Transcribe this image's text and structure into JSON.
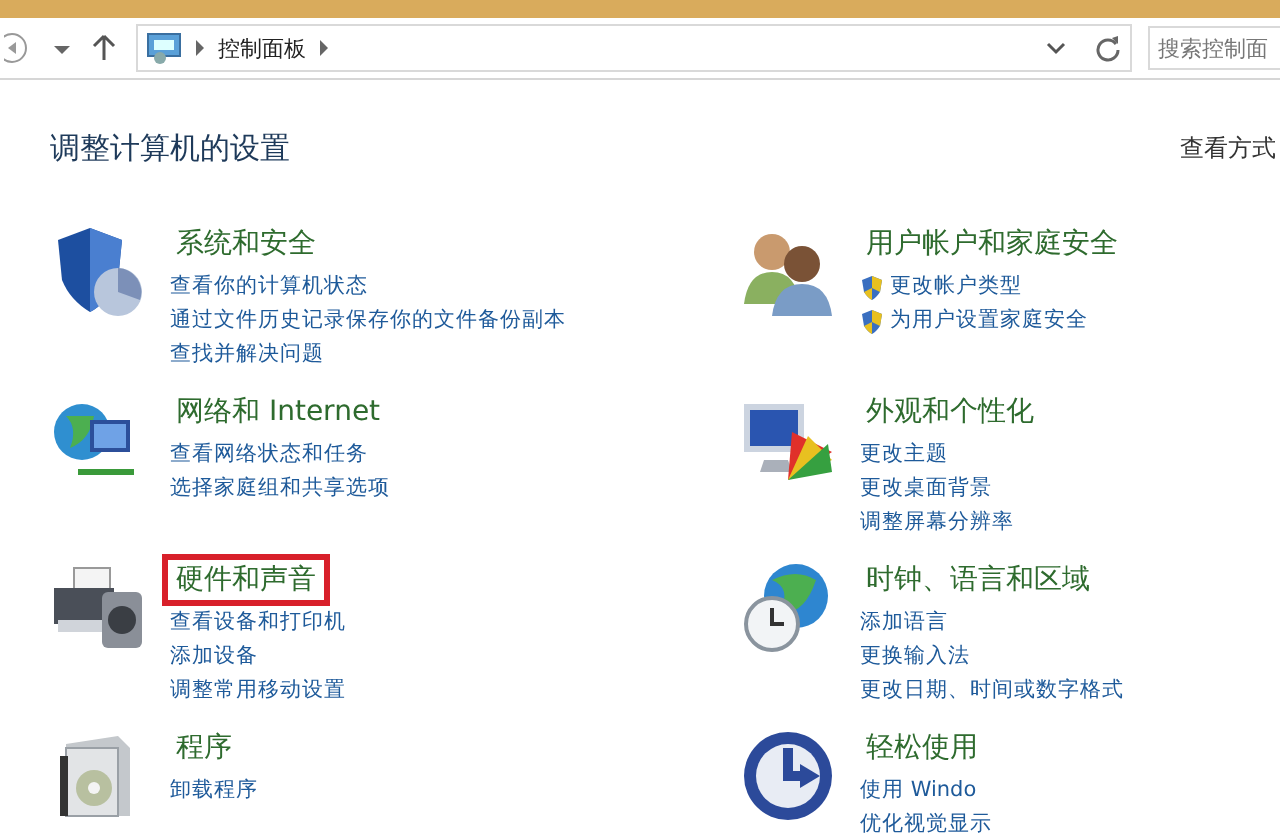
{
  "address_bar": {
    "path": "控制面板"
  },
  "search": {
    "placeholder": "搜索控制面"
  },
  "heading": "调整计算机的设置",
  "view_by": "查看方式",
  "categories": [
    {
      "title": "系统和安全",
      "highlighted": false,
      "links": [
        {
          "text": "查看你的计算机状态",
          "uac": false
        },
        {
          "text": "通过文件历史记录保存你的文件备份副本",
          "uac": false
        },
        {
          "text": "查找并解决问题",
          "uac": false
        }
      ]
    },
    {
      "title": "用户帐户和家庭安全",
      "highlighted": false,
      "links": [
        {
          "text": "更改帐户类型",
          "uac": true
        },
        {
          "text": "为用户设置家庭安全",
          "uac": true
        }
      ]
    },
    {
      "title": "网络和 Internet",
      "highlighted": false,
      "links": [
        {
          "text": "查看网络状态和任务",
          "uac": false
        },
        {
          "text": "选择家庭组和共享选项",
          "uac": false
        }
      ]
    },
    {
      "title": "外观和个性化",
      "highlighted": false,
      "links": [
        {
          "text": "更改主题",
          "uac": false
        },
        {
          "text": "更改桌面背景",
          "uac": false
        },
        {
          "text": "调整屏幕分辨率",
          "uac": false
        }
      ]
    },
    {
      "title": "硬件和声音",
      "highlighted": true,
      "links": [
        {
          "text": "查看设备和打印机",
          "uac": false
        },
        {
          "text": "添加设备",
          "uac": false
        },
        {
          "text": "调整常用移动设置",
          "uac": false
        }
      ]
    },
    {
      "title": "时钟、语言和区域",
      "highlighted": false,
      "links": [
        {
          "text": "添加语言",
          "uac": false
        },
        {
          "text": "更换输入法",
          "uac": false
        },
        {
          "text": "更改日期、时间或数字格式",
          "uac": false
        }
      ]
    },
    {
      "title": "程序",
      "highlighted": false,
      "links": [
        {
          "text": "卸载程序",
          "uac": false
        }
      ]
    },
    {
      "title": "轻松使用",
      "highlighted": false,
      "links": [
        {
          "text": "使用 Windo",
          "uac": false
        },
        {
          "text": "优化视觉显示",
          "uac": false
        }
      ]
    }
  ]
}
